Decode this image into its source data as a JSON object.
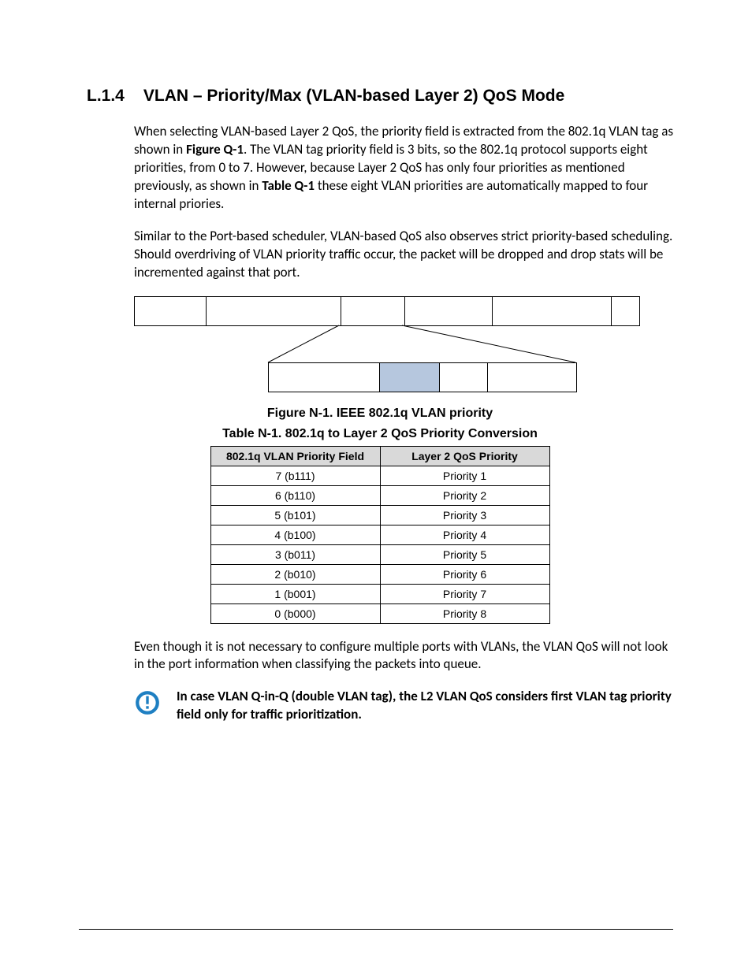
{
  "heading": {
    "number": "L.1.4",
    "title": "VLAN – Priority/Max (VLAN-based Layer 2) QoS Mode"
  },
  "paragraphs": {
    "p1_a": "When selecting VLAN-based Layer 2 QoS, the priority field is extracted from the 802.1q VLAN tag as shown in ",
    "p1_b": "Figure Q-1",
    "p1_c": ". The VLAN tag priority field is 3 bits, so the 802.1q protocol supports eight priorities, from 0 to 7. However, because Layer 2 QoS has only four priorities as mentioned previously, as shown in ",
    "p1_d": "Table Q-1",
    "p1_e": " these eight VLAN priorities are automatically mapped to four internal priories.",
    "p2": "Similar to the Port-based scheduler, VLAN-based QoS also observes strict priority-based scheduling. Should overdriving of VLAN priority traffic occur, the packet will be dropped and drop stats will be incremented against that port.",
    "p3": "Even though it is not necessary to configure multiple ports with VLANs, the VLAN QoS will not look in the port information when classifying the packets into queue."
  },
  "figure_caption": "Figure N-1. IEEE 802.1q VLAN priority",
  "table_caption": "Table N-1. 802.1q to Layer 2 QoS Priority Conversion",
  "table": {
    "headers": [
      "802.1q VLAN Priority Field",
      "Layer 2 QoS Priority"
    ],
    "rows": [
      [
        "7 (b111)",
        "Priority 1"
      ],
      [
        "6 (b110)",
        "Priority 2"
      ],
      [
        "5 (b101)",
        "Priority 3"
      ],
      [
        "4 (b100)",
        "Priority 4"
      ],
      [
        "3 (b011)",
        "Priority 5"
      ],
      [
        "2 (b010)",
        "Priority 6"
      ],
      [
        "1 (b001)",
        "Priority 7"
      ],
      [
        "0 (b000)",
        "Priority 8"
      ]
    ]
  },
  "note": "In case VLAN Q-in-Q (double VLAN tag), the L2 VLAN QoS considers first VLAN tag priority field only for traffic prioritization."
}
